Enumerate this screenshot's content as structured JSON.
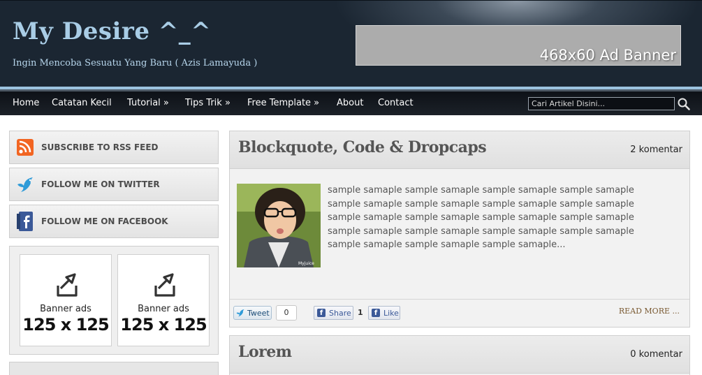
{
  "header": {
    "title": "My Desire ^_^",
    "description": "Ingin Mencoba Sesuatu Yang Baru ( Azis Lamayuda )",
    "ad_text": "468x60 Ad Banner"
  },
  "nav": {
    "items": [
      {
        "label": "Home"
      },
      {
        "label": "Catatan Kecil"
      },
      {
        "label": "Tutorial »"
      },
      {
        "label": "Tips Trik »"
      },
      {
        "label": "Free Template »"
      },
      {
        "label": "About"
      },
      {
        "label": "Contact"
      }
    ],
    "search_placeholder": "Cari Artikel Disini..."
  },
  "sidebar": {
    "social": [
      {
        "label": "SUBSCRIBE TO RSS FEED",
        "icon": "rss-icon"
      },
      {
        "label": "FOLLOW ME ON TWITTER",
        "icon": "twitter-bird-icon"
      },
      {
        "label": "FOLLOW ME ON FACEBOOK",
        "icon": "facebook-icon"
      }
    ],
    "ads": [
      {
        "line1": "Banner ads",
        "line2": "125 x 125"
      },
      {
        "line1": "Banner ads",
        "line2": "125 x 125"
      }
    ]
  },
  "posts": [
    {
      "title": "Blockquote, Code & Dropcaps",
      "comments": "2 komentar",
      "excerpt": "sample samaple sample samaple sample samaple sample samaple sample samaple sample samaple sample samaple sample samaple sample samaple sample samaple sample samaple sample samaple sample samaple sample samaple sample samaple sample samaple sample samaple sample samaple sample samaple...",
      "tweet_label": "Tweet",
      "tweet_count": "0",
      "share_label": "Share",
      "share_count": "1",
      "like_label": "Like",
      "read_more": "READ MORE ..."
    },
    {
      "title": "Lorem",
      "comments": "0 komentar"
    }
  ],
  "colors": {
    "title": "#a9cde6",
    "accent_stripe": "#9cc3e0",
    "nav_bg": "#0d1117",
    "read_more": "#7a5a32"
  }
}
